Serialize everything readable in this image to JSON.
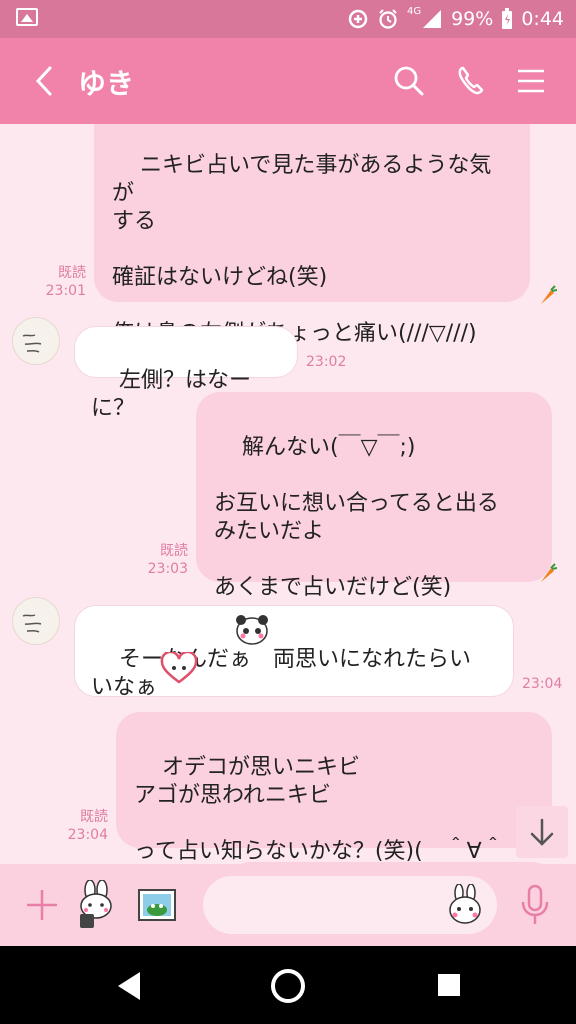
{
  "status_bar": {
    "network": "4G",
    "battery": "99%",
    "time": "0:44"
  },
  "header": {
    "title": "ゆき"
  },
  "messages": [
    {
      "text": "ニキビ占いで見た事があるような気が\nする\n\n確証はないけどね(笑)\n\n俺は鼻の左側がちょっと痛い(///▽///)",
      "read": "既読",
      "time": "23:01"
    },
    {
      "text": "左側？はなーに？",
      "time": "23:02"
    },
    {
      "text": "解んない(￣▽￣;)\n\nお互いに想い合ってると出る\nみたいだよ\n\nあくまで占いだけど(笑)",
      "read": "既読",
      "time": "23:03"
    },
    {
      "text": "そーなんだぁ　両思いになれたらい\nいなぁ",
      "time": "23:04"
    },
    {
      "text": "オデコが思いニキビ\nアゴが思われニキビ\n\nって占い知らないかな？(笑)(　＾∀＾",
      "read": "既読",
      "time": "23:04"
    }
  ],
  "icons": {
    "back": "chevron-left-icon",
    "search": "search-icon",
    "call": "phone-icon",
    "menu": "menu-icon",
    "plus": "plus-icon",
    "sticker": "rabbit-sticker-icon",
    "photo": "photo-icon",
    "mic": "mic-icon"
  },
  "colors": {
    "header": "#f183ab",
    "status_bar": "#d9779a",
    "chat_bg": "#fde8ef",
    "my_bubble": "#fbd1e0",
    "accent": "#e07da2"
  }
}
